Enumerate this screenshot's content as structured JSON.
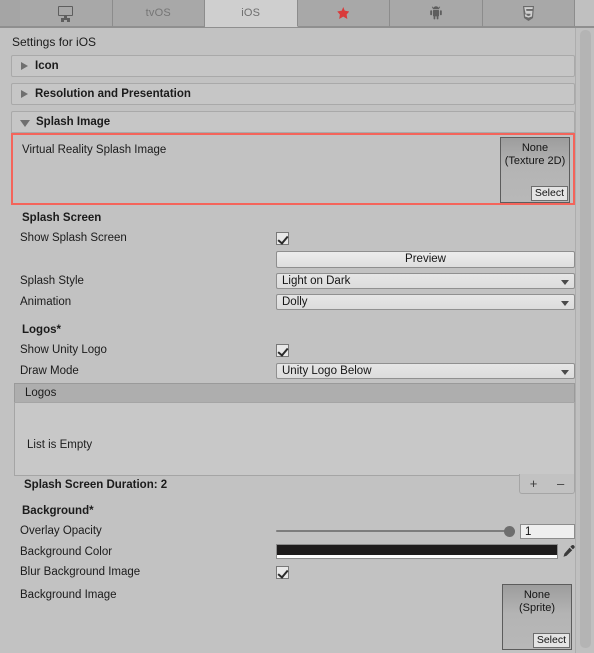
{
  "tabs": [
    {
      "label": "",
      "icon": "monitor-icon",
      "selected": false,
      "name": "tab-standalone"
    },
    {
      "label": "tvOS",
      "icon": "",
      "selected": false,
      "name": "tab-tvos"
    },
    {
      "label": "iOS",
      "icon": "",
      "selected": true,
      "name": "tab-ios"
    },
    {
      "label": "",
      "icon": "ps4-icon",
      "selected": false,
      "name": "tab-ps4"
    },
    {
      "label": "",
      "icon": "android-icon",
      "selected": false,
      "name": "tab-android"
    },
    {
      "label": "",
      "icon": "html5-icon",
      "selected": false,
      "name": "tab-webgl"
    }
  ],
  "settings_title": "Settings for iOS",
  "foldouts": [
    {
      "title": "Icon",
      "open": false
    },
    {
      "title": "Resolution and Presentation",
      "open": false
    },
    {
      "title": "Splash Image",
      "open": true
    }
  ],
  "vr_splash": {
    "label": "Virtual Reality Splash Image",
    "object_none": "None",
    "object_type": "(Texture 2D)",
    "select_label": "Select",
    "highlight_color": "#f4645a"
  },
  "splash_screen": {
    "section": "Splash Screen",
    "show_splash_label": "Show Splash Screen",
    "show_splash_checked": true,
    "preview_label": "Preview",
    "splash_style_label": "Splash Style",
    "splash_style_value": "Light on Dark",
    "animation_label": "Animation",
    "animation_value": "Dolly"
  },
  "logos": {
    "section": "Logos*",
    "show_unity_logo_label": "Show Unity Logo",
    "show_unity_logo_checked": true,
    "draw_mode_label": "Draw Mode",
    "draw_mode_value": "Unity Logo Below",
    "list_header": "Logos",
    "list_empty": "List is Empty",
    "duration_label": "Splash Screen Duration: 2",
    "add_label": "+",
    "remove_label": "–"
  },
  "background": {
    "section": "Background*",
    "overlay_opacity_label": "Overlay Opacity",
    "overlay_opacity_value": "1",
    "overlay_opacity_pct": 100,
    "background_color_label": "Background Color",
    "background_color_value": "#1e1c1c",
    "blur_label": "Blur Background Image",
    "blur_checked": true,
    "background_image_label": "Background Image",
    "object_none": "None",
    "object_type": "(Sprite)",
    "select_label": "Select"
  }
}
